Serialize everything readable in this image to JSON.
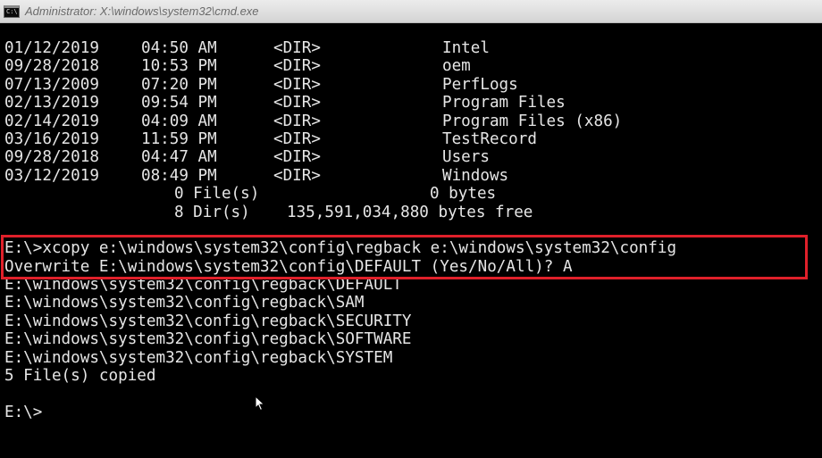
{
  "window": {
    "title": "Administrator: X:\\windows\\system32\\cmd.exe",
    "icon": "cmd-icon"
  },
  "listing": [
    {
      "date": "01/12/2019",
      "time": "04:50 AM",
      "type": "<DIR>",
      "name": "Intel"
    },
    {
      "date": "09/28/2018",
      "time": "10:53 PM",
      "type": "<DIR>",
      "name": "oem"
    },
    {
      "date": "07/13/2009",
      "time": "07:20 PM",
      "type": "<DIR>",
      "name": "PerfLogs"
    },
    {
      "date": "02/13/2019",
      "time": "09:54 PM",
      "type": "<DIR>",
      "name": "Program Files"
    },
    {
      "date": "02/14/2019",
      "time": "04:09 AM",
      "type": "<DIR>",
      "name": "Program Files (x86)"
    },
    {
      "date": "03/16/2019",
      "time": "11:59 PM",
      "type": "<DIR>",
      "name": "TestRecord"
    },
    {
      "date": "09/28/2018",
      "time": "04:47 AM",
      "type": "<DIR>",
      "name": "Users"
    },
    {
      "date": "03/12/2019",
      "time": "08:49 PM",
      "type": "<DIR>",
      "name": "Windows"
    }
  ],
  "summary": {
    "files_count": "0 File(s)",
    "files_bytes": "0 bytes",
    "dirs_count": "8 Dir(s)",
    "dirs_free": "135,591,034,880 bytes free"
  },
  "command": {
    "prompt_line": "E:\\>xcopy e:\\windows\\system32\\config\\regback e:\\windows\\system32\\config",
    "overwrite_line": "Overwrite E:\\windows\\system32\\config\\DEFAULT (Yes/No/All)? A"
  },
  "copied": [
    "E:\\windows\\system32\\config\\regback\\DEFAULT",
    "E:\\windows\\system32\\config\\regback\\SAM",
    "E:\\windows\\system32\\config\\regback\\SECURITY",
    "E:\\windows\\system32\\config\\regback\\SOFTWARE",
    "E:\\windows\\system32\\config\\regback\\SYSTEM"
  ],
  "result": "5 File(s) copied",
  "prompt": "E:\\>",
  "colors": {
    "background": "#000000",
    "text": "#e6e6e6",
    "highlight_box": "#e0202a"
  }
}
